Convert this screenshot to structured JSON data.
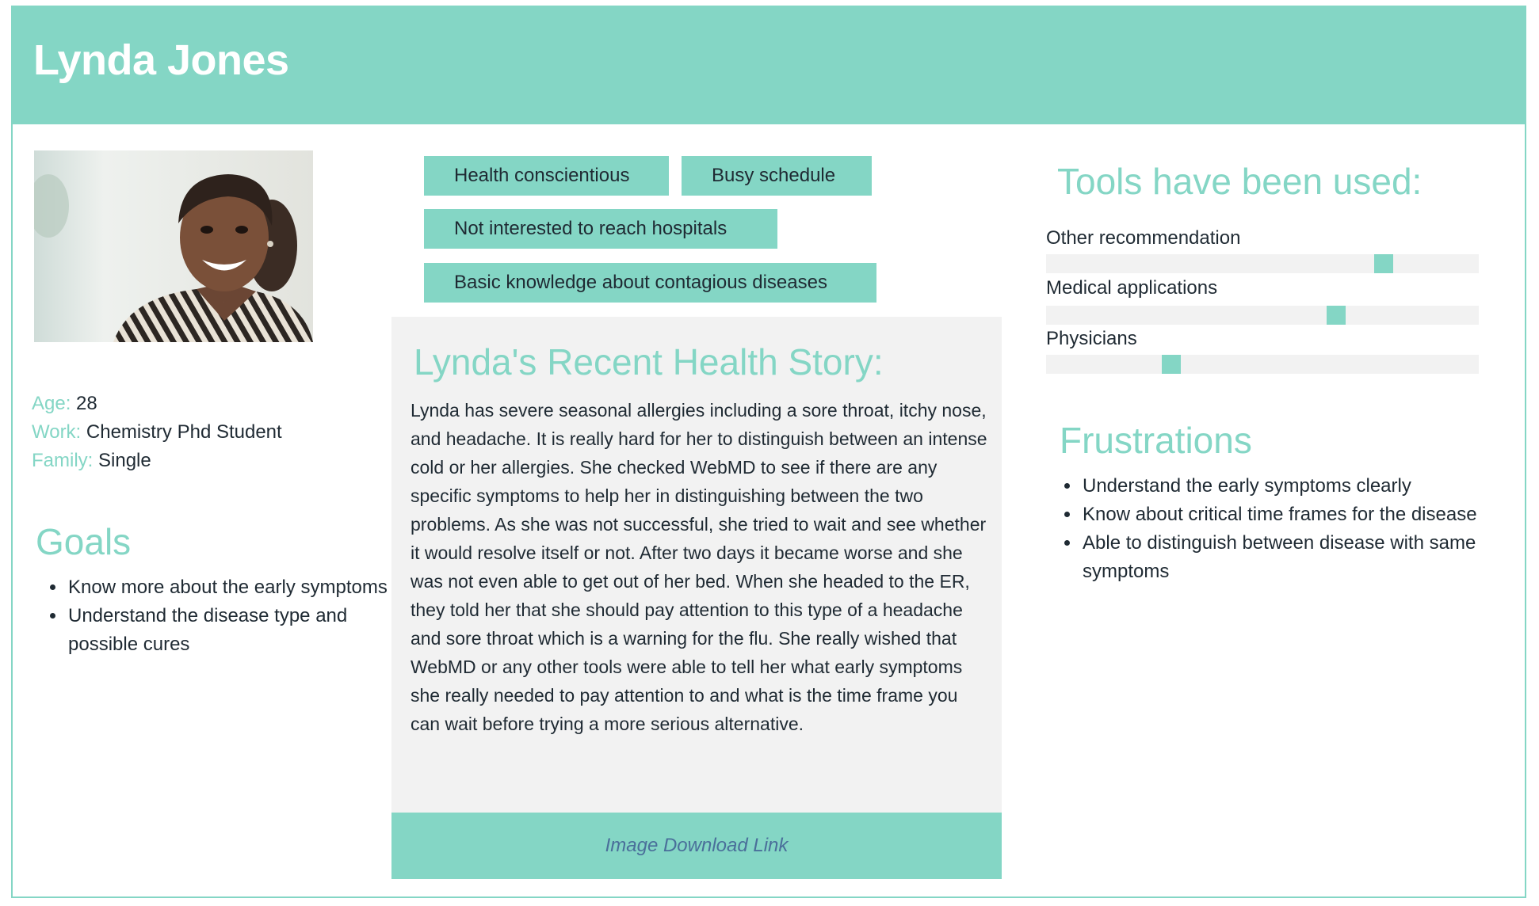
{
  "header": {
    "title": "Lynda Jones"
  },
  "profile": {
    "age_label": "Age:",
    "age": "28",
    "work_label": "Work:",
    "work": "Chemistry Phd Student",
    "family_label": "Family:",
    "family": "Single"
  },
  "goals": {
    "title": "Goals",
    "items": [
      "Know more about the early symptoms",
      "Understand the disease type and possible cures"
    ]
  },
  "tags": [
    "Health conscientious",
    "Busy schedule",
    "Not interested to reach hospitals",
    "Basic knowledge about contagious diseases"
  ],
  "story": {
    "title": "Lynda's Recent Health Story:",
    "text": "Lynda has severe seasonal allergies including a sore throat, itchy nose, and headache. It is really hard for her to distinguish between an intense cold or her allergies. She checked WebMD to see if there are any specific symptoms to help her in distinguishing between the two problems. As she was not successful, she tried to wait and see whether it would resolve itself or not. After two days it became worse and she was not even able to get out of her bed. When she headed to the ER, they told her that she should pay attention to this type of a headache and sore throat which is a warning for the flu. She really wished that WebMD or any other tools were able to tell her what early symptoms she really needed to pay attention to and what is the time frame you can wait before trying a more serious alternative."
  },
  "download": {
    "label": "Image Download Link"
  },
  "tools": {
    "title": "Tools have been used:",
    "items": [
      {
        "label": "Other recommendation",
        "level": 0.78
      },
      {
        "label": "Medical applications",
        "level": 0.67
      },
      {
        "label": "Physicians",
        "level": 0.29
      }
    ]
  },
  "frustrations": {
    "title": "Frustrations",
    "items": [
      "Understand the early symptoms clearly",
      "Know about critical time frames for the disease",
      "Able to distinguish between disease with same symptoms"
    ]
  },
  "colors": {
    "accent": "#84d6c5",
    "panel": "#f2f2f2",
    "text": "#1f2a33",
    "link": "#4a6f9a"
  }
}
